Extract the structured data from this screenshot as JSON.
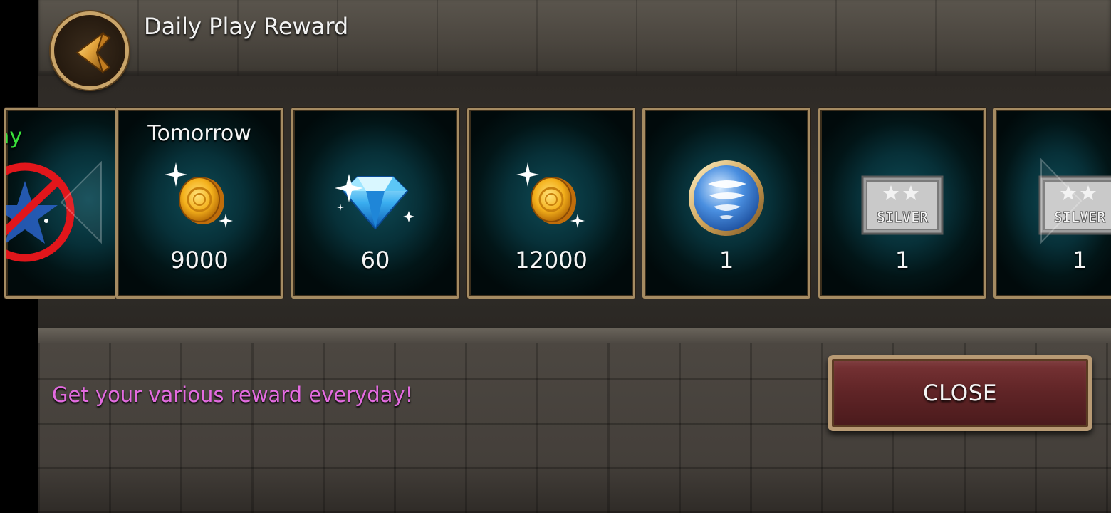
{
  "header": {
    "title": "Daily Play Reward",
    "back_icon": "back-arrow-icon"
  },
  "rewards": [
    {
      "label": "ay",
      "count": "",
      "icon": "claimed-stamp-icon",
      "label_color": "#39e23a"
    },
    {
      "label": "Tomorrow",
      "count": "9000",
      "icon": "gold-coin-icon"
    },
    {
      "label": "",
      "count": "60",
      "icon": "diamond-gem-icon"
    },
    {
      "label": "",
      "count": "12000",
      "icon": "gold-coin-icon"
    },
    {
      "label": "",
      "count": "1",
      "icon": "whirlwind-orb-icon"
    },
    {
      "label": "",
      "count": "1",
      "icon": "silver-ticket-icon",
      "ticket_text": "SILVER"
    },
    {
      "label": "",
      "count": "1",
      "icon": "silver-ticket-icon",
      "ticket_text": "SILVER"
    }
  ],
  "footer": {
    "tagline": "Get your various reward everyday!",
    "close_label": "CLOSE"
  },
  "colors": {
    "tagline": "#e36be0",
    "today_label": "#39e23a",
    "close_button": "#6a2a2c",
    "card_glow": "#0e4a55"
  }
}
